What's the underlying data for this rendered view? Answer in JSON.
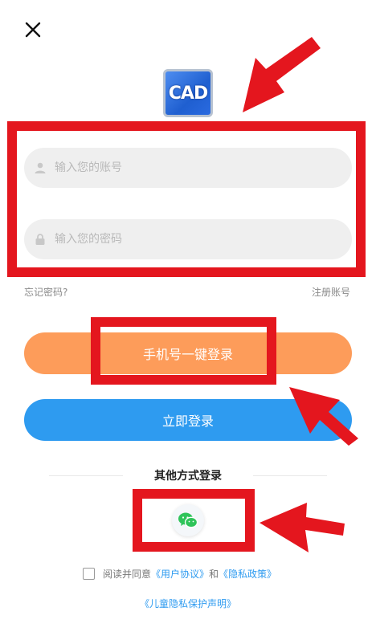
{
  "logo_text": "CAD",
  "account": {
    "placeholder": "输入您的账号"
  },
  "password": {
    "placeholder": "输入您的密码"
  },
  "links": {
    "forgot": "忘记密码?",
    "register": "注册账号"
  },
  "buttons": {
    "phone_login": "手机号一键登录",
    "login": "立即登录"
  },
  "other_login_title": "其他方式登录",
  "agreement": {
    "prefix": "阅读并同意",
    "user_agreement": "《用户协议》",
    "and": "和",
    "privacy_policy": "《隐私政策》"
  },
  "child_privacy": "《儿童隐私保护声明》",
  "colors": {
    "phone_button": "#fd9c5a",
    "login_button": "#2e9bf0",
    "annotation_red": "#e4161e",
    "wechat_green": "#2fc45a"
  },
  "icons": [
    "close-icon",
    "user-icon",
    "lock-icon",
    "wechat-icon",
    "arrow-annotation"
  ]
}
